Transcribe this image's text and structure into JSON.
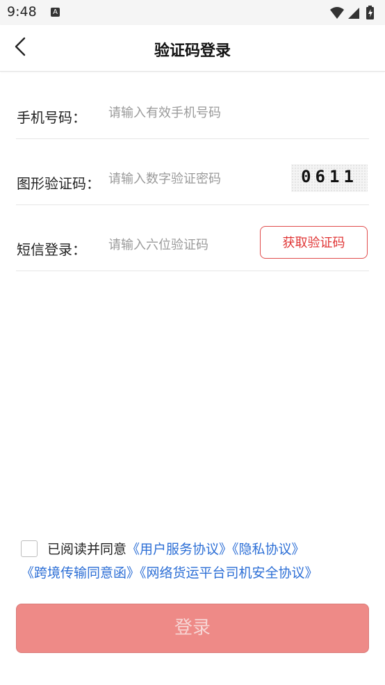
{
  "status_bar": {
    "time": "9:48",
    "notification_icon_letter": "A",
    "icons": [
      "wifi-icon",
      "signal-icon",
      "battery-charging-icon"
    ]
  },
  "header": {
    "back_icon": "chevron-left-icon",
    "title": "验证码登录"
  },
  "form": {
    "phone": {
      "label": "手机号码：",
      "placeholder": "请输入有效手机号码",
      "value": ""
    },
    "captcha": {
      "label": "图形验证码：",
      "placeholder": "请输入数字验证密码",
      "value": "",
      "image_text": "0611"
    },
    "sms": {
      "label": "短信登录：",
      "placeholder": "请输入六位验证码",
      "value": "",
      "button_label": "获取验证码"
    }
  },
  "agreement": {
    "checked": false,
    "prefix": "已阅读并同意",
    "links": [
      "《用户服务协议》",
      "《隐私协议》",
      "《跨境传输同意函》",
      "《网络货运平台司机安全协议》"
    ]
  },
  "login_button": {
    "label": "登录"
  },
  "colors": {
    "accent_red": "#e03535",
    "link_blue": "#2d6fd6",
    "login_button_bg": "#ee8a87"
  }
}
